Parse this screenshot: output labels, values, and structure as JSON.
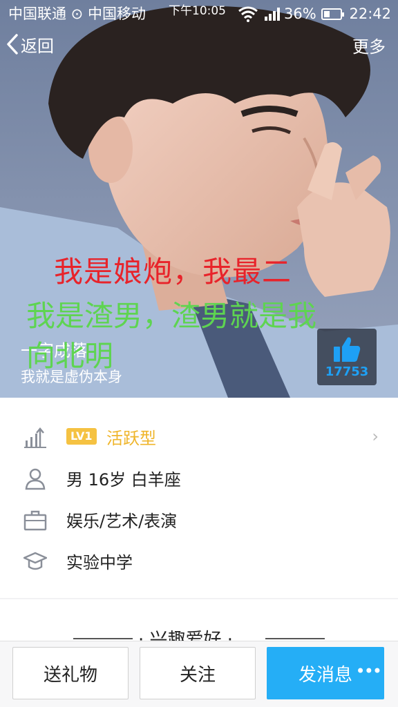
{
  "status_bar": {
    "carrier": "中国联通 ⊙ 中国移动",
    "clock_left": "下午10:05",
    "battery": "36%",
    "battery_level": 0.36,
    "time": "22:42"
  },
  "nav": {
    "back_label": "返回",
    "more_label": "更多"
  },
  "profile": {
    "overlay_red": "我是娘炮，我最二",
    "overlay_green_1": "我是渣男，渣男就是我",
    "overlay_green_2": "向北明",
    "name": "一字成落",
    "signature": "我就是虚伪本身",
    "like_count": "17753"
  },
  "info": {
    "level_badge": "LV1",
    "level_type": "活跃型",
    "basic": "男  16岁  白羊座",
    "occupation": "娱乐/艺术/表演",
    "school": "实验中学",
    "icons": [
      "level-icon",
      "person-icon",
      "briefcase-icon",
      "graduation-cap-icon"
    ]
  },
  "interest": {
    "title": "· 兴趣爱好 ·"
  },
  "actions": {
    "gift": "送礼物",
    "follow": "关注",
    "message": "发消息"
  },
  "colors": {
    "accent": "#25aef6",
    "level": "#efb52a",
    "overlay_red": "#e8232a",
    "overlay_green": "#5ed451"
  }
}
